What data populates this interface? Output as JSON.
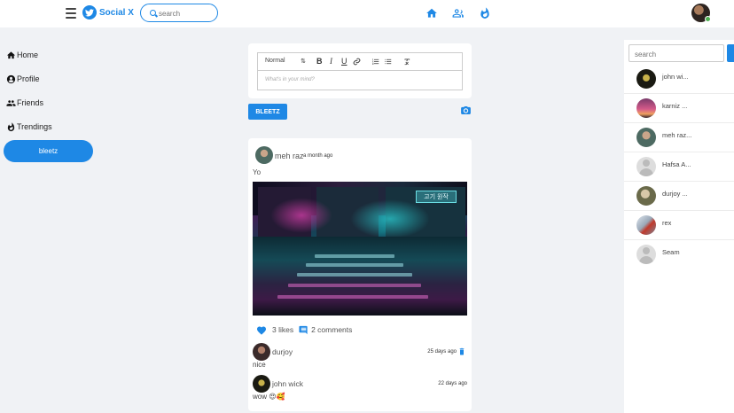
{
  "app": {
    "brand": "Social X",
    "search_placeholder": "search",
    "accent_color": "#1e88e5"
  },
  "topbar": {
    "nav_icons": [
      "home-icon",
      "friends-icon",
      "trending-icon"
    ]
  },
  "sidebar": {
    "items": [
      {
        "label": "Home",
        "icon": "home-icon"
      },
      {
        "label": "Profile",
        "icon": "profile-icon"
      },
      {
        "label": "Friends",
        "icon": "friends-icon"
      },
      {
        "label": "Trendings",
        "icon": "fire-icon"
      }
    ],
    "button_label": "bleetz"
  },
  "composer": {
    "format_select": "Normal",
    "toolbar": [
      "B",
      "I",
      "U"
    ],
    "placeholder": "What's in your mind?",
    "submit_label": "BLEETZ"
  },
  "post": {
    "author": "meh raz",
    "time": "a month ago",
    "text": "Yo",
    "image_sign_text": "고기 원작",
    "likes": "3 likes",
    "comments_count": "2 comments",
    "comments": [
      {
        "author": "durjoy",
        "date": "25 days ago",
        "text": "nice",
        "deletable": true
      },
      {
        "author": "john wick",
        "date": "22 days ago",
        "text": "wow 😍🥰",
        "deletable": false
      }
    ]
  },
  "right_panel": {
    "search_placeholder": "search",
    "friends": [
      {
        "name": "john wi..."
      },
      {
        "name": "karniz ..."
      },
      {
        "name": "meh raz..."
      },
      {
        "name": "Hafsa A..."
      },
      {
        "name": "durjoy ..."
      },
      {
        "name": "rex"
      },
      {
        "name": "Seam"
      }
    ]
  }
}
